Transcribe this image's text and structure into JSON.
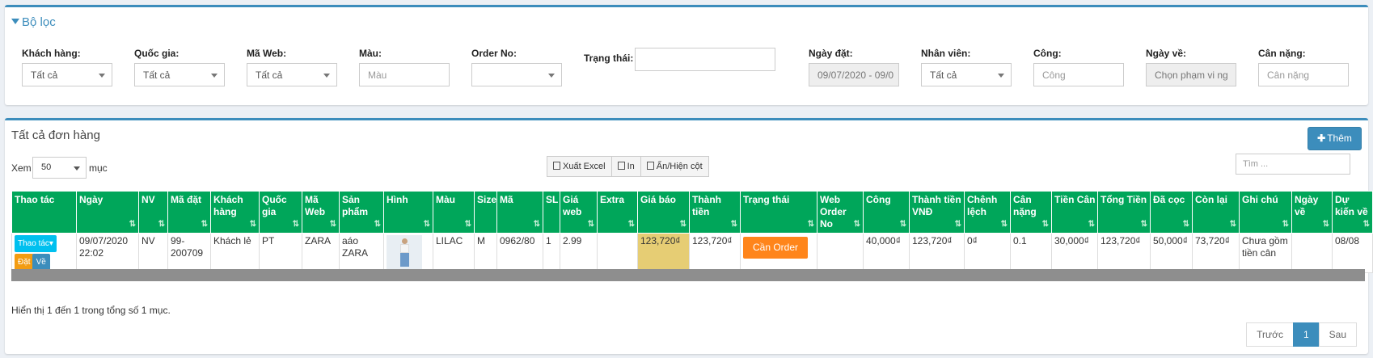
{
  "filter": {
    "title": "Bộ lọc",
    "fields": [
      {
        "label": "Khách hàng:",
        "value": "Tất cả",
        "type": "select"
      },
      {
        "label": "Quốc gia:",
        "value": "Tất cả",
        "type": "select"
      },
      {
        "label": "Mã Web:",
        "value": "Tất cả",
        "type": "select"
      },
      {
        "label": "Màu:",
        "placeholder": "Màu",
        "type": "input"
      },
      {
        "label": "Order No:",
        "value": "",
        "type": "select"
      },
      {
        "label": "Trạng thái:",
        "value": "",
        "type": "input"
      },
      {
        "label": "Ngày đặt:",
        "value": "09/07/2020 - 09/0",
        "type": "disabled"
      },
      {
        "label": "Nhân viên:",
        "value": "Tất cả",
        "type": "select"
      },
      {
        "label": "Công:",
        "placeholder": "Công",
        "type": "input"
      },
      {
        "label": "Ngày về:",
        "placeholder": "Chọn phạm vi ng",
        "type": "disabled"
      },
      {
        "label": "Cân nặng:",
        "placeholder": "Cân nặng",
        "type": "input"
      }
    ]
  },
  "orders": {
    "title": "Tất cả đơn hàng",
    "add_label": "Thêm",
    "show_label": "Xem",
    "page_size": "50",
    "items_label": "mục",
    "toolbar": {
      "excel": "Xuất Excel",
      "print": "In",
      "columns": "Ẩn/Hiện cột"
    },
    "search_placeholder": "Tìm ...",
    "columns": [
      "Thao tác",
      "Ngày",
      "NV",
      "Mã đặt",
      "Khách hàng",
      "Quốc gia",
      "Mã Web",
      "Sản phẩm",
      "Hình",
      "Màu",
      "Size",
      "Mã",
      "SL",
      "Giá web",
      "Extra",
      "Giá báo",
      "Thành tiền",
      "Trạng thái",
      "Web Order No",
      "Công",
      "Thành tiền VNĐ",
      "Chênh lệch",
      "Cân nặng",
      "Tiền Cân",
      "Tổng Tiền",
      "Đã cọc",
      "Còn lại",
      "Ghi chú",
      "Ngày về",
      "Dự kiến về"
    ],
    "row": {
      "action": "Thao tác",
      "btn_dat": "Đặt",
      "btn_ve": "Về",
      "date": "09/07/2020 22:02",
      "nv": "NV",
      "ma_dat": "99-200709",
      "customer": "Khách lẻ",
      "country": "PT",
      "web": "ZARA",
      "product": "aáo ZARA",
      "color": "LILAC",
      "size": "M",
      "code": "0962/80",
      "qty": "1",
      "web_price": "2.99",
      "extra": "",
      "quote": "123,720₫",
      "subtotal": "123,720₫",
      "status": "Cần Order",
      "web_order_no": "",
      "fee": "40,000₫",
      "subtotal_vnd": "123,720₫",
      "diff": "0₫",
      "weight": "0.1",
      "weight_fee": "30,000₫",
      "total": "123,720₫",
      "deposit": "50,000₫",
      "remaining": "73,720₫",
      "note": "Chưa gồm tiền cân",
      "arrival": "",
      "expected": "08/08"
    },
    "info": "Hiển thị 1 đến 1 trong tổng số 1 mục.",
    "pager": {
      "prev": "Trước",
      "page": "1",
      "next": "Sau"
    }
  }
}
